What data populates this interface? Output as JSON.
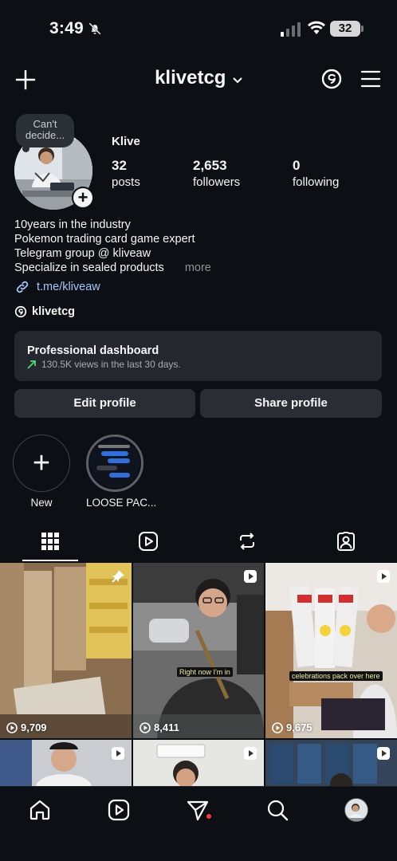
{
  "status_bar": {
    "time": "3:49",
    "battery": "32"
  },
  "header": {
    "username": "klivetcg"
  },
  "profile": {
    "note": "Can't decide...",
    "display_name": "Klive",
    "stats": [
      {
        "num": "32",
        "label": "posts"
      },
      {
        "num": "2,653",
        "label": "followers"
      },
      {
        "num": "0",
        "label": "following"
      }
    ],
    "bio": [
      "10years in the industry",
      "Pokemon trading card game expert",
      "Telegram group @ kliveaw",
      "Specialize in sealed products"
    ],
    "more_label": "more",
    "link": "t.me/kliveaw",
    "threads_handle": "klivetcg"
  },
  "dashboard": {
    "title": "Professional dashboard",
    "subtitle": "130.5K views in the last 30 days."
  },
  "buttons": {
    "edit": "Edit profile",
    "share": "Share profile"
  },
  "highlights": [
    {
      "label": "New"
    },
    {
      "label": "LOOSE PAC..."
    }
  ],
  "grid": [
    {
      "views": "9,709",
      "pinned": true
    },
    {
      "views": "8,411",
      "caption": "Right now I'm in"
    },
    {
      "views": "9,675",
      "caption": "celebrations pack over here"
    },
    {
      "views": ""
    },
    {
      "views": ""
    },
    {
      "views": ""
    }
  ],
  "colors": {
    "background": "#0c1014",
    "card": "#24282e",
    "link": "#a8c6fb",
    "notification": "#ff3040",
    "trend": "#4fd67a"
  }
}
